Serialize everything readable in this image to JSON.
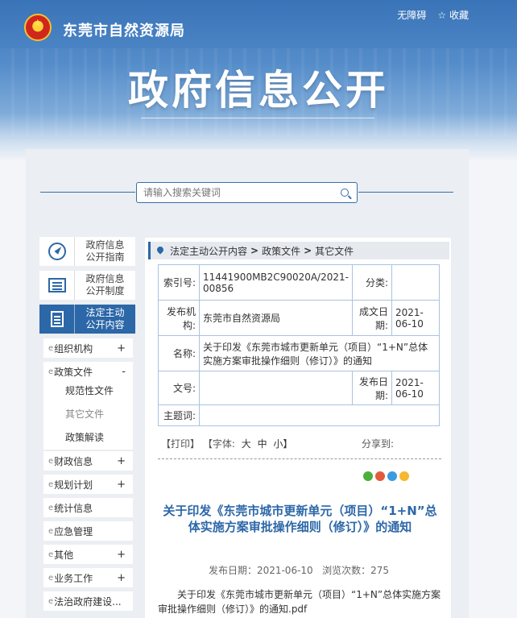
{
  "header": {
    "site_name": "东莞市自然资源局",
    "accessibility": "无障碍",
    "favorite": "☆ 收藏",
    "banner_title": "政府信息公开"
  },
  "search": {
    "placeholder": "请输入搜索关键词"
  },
  "sidebar": {
    "cards": [
      {
        "line1": "政府信息",
        "line2": "公开指南",
        "icon": "compass-icon"
      },
      {
        "line1": "政府信息",
        "line2": "公开制度",
        "icon": "document-list-icon"
      },
      {
        "line1": "法定主动",
        "line2": "公开内容",
        "icon": "document-icon"
      }
    ],
    "menu": [
      {
        "label": "组织机构",
        "toggle": "+"
      },
      {
        "label": "政策文件",
        "toggle": "-"
      },
      {
        "label": "财政信息",
        "toggle": "+"
      },
      {
        "label": "规划计划",
        "toggle": "+"
      },
      {
        "label": "统计信息",
        "toggle": ""
      },
      {
        "label": "应急管理",
        "toggle": ""
      },
      {
        "label": "其他",
        "toggle": "+"
      },
      {
        "label": "业务工作",
        "toggle": "+"
      },
      {
        "label": "法治政府建设...",
        "toggle": ""
      }
    ],
    "submenu": [
      "规范性文件",
      "其它文件",
      "政策解读"
    ]
  },
  "breadcrumb": {
    "items": [
      "法定主动公开内容",
      "政策文件",
      "其它文件"
    ],
    "separator": ">"
  },
  "meta": {
    "index_label": "索引号:",
    "index_value": "11441900MB2C90020A/2021-00856",
    "category_label": "分类:",
    "category_value": "",
    "issuer_label": "发布机构:",
    "issuer_value": "东莞市自然资源局",
    "created_label": "成文日期:",
    "created_value": "2021-06-10",
    "name_label": "名称:",
    "name_value": "关于印发《东莞市城市更新单元（项目）“1+N”总体实施方案审批操作细则（修订）》的通知",
    "docno_label": "文号:",
    "docno_value": "",
    "published_label": "发布日期:",
    "published_value": "2021-06-10",
    "subject_label": "主题词:",
    "subject_value": ""
  },
  "tools": {
    "print": "【打印】",
    "font": "【字体:",
    "large": "大",
    "medium": "中",
    "small": "小】",
    "share": "分享到:"
  },
  "share_colors": [
    "#4caf3c",
    "#e25b3a",
    "#3a9be0",
    "#f5b82e"
  ],
  "article": {
    "title": "关于印发《东莞市城市更新单元（项目）“1+N”总体实施方案审批操作细则（修订）》的通知",
    "published": "发布日期：2021-06-10",
    "views": "浏览次数：275",
    "body": "关于印发《东莞市城市更新单元（项目）“1+N”总体实施方案审批操作细则（修订）》的通知.pdf"
  }
}
